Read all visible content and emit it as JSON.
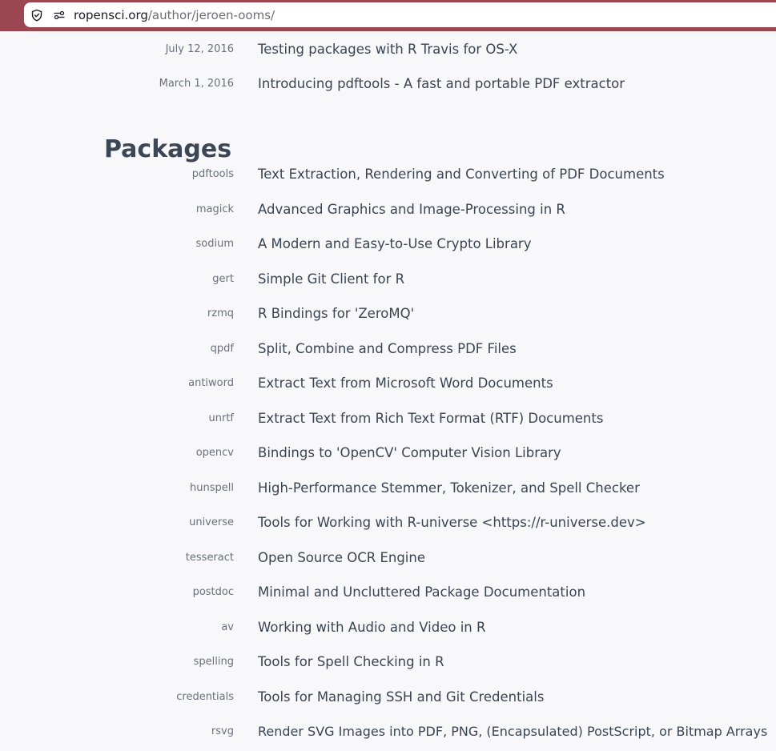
{
  "browser": {
    "url_host": "ropensci.org",
    "url_path": "/author/jeroen-ooms/"
  },
  "posts": [
    {
      "date": "July 12, 2016",
      "title": "Testing packages with R Travis for OS-X"
    },
    {
      "date": "March 1, 2016",
      "title": "Introducing pdftools - A fast and portable PDF extractor"
    }
  ],
  "packages_heading": "Packages",
  "packages": [
    {
      "name": "pdftools",
      "description": "Text Extraction, Rendering and Converting of PDF Documents"
    },
    {
      "name": "magick",
      "description": "Advanced Graphics and Image-Processing in R"
    },
    {
      "name": "sodium",
      "description": "A Modern and Easy-to-Use Crypto Library"
    },
    {
      "name": "gert",
      "description": "Simple Git Client for R"
    },
    {
      "name": "rzmq",
      "description": "R Bindings for 'ZeroMQ'"
    },
    {
      "name": "qpdf",
      "description": "Split, Combine and Compress PDF Files"
    },
    {
      "name": "antiword",
      "description": "Extract Text from Microsoft Word Documents"
    },
    {
      "name": "unrtf",
      "description": "Extract Text from Rich Text Format (RTF) Documents"
    },
    {
      "name": "opencv",
      "description": "Bindings to 'OpenCV' Computer Vision Library"
    },
    {
      "name": "hunspell",
      "description": "High-Performance Stemmer, Tokenizer, and Spell Checker"
    },
    {
      "name": "universe",
      "description": "Tools for Working with R-universe <https://r-universe.dev>"
    },
    {
      "name": "tesseract",
      "description": "Open Source OCR Engine"
    },
    {
      "name": "postdoc",
      "description": "Minimal and Uncluttered Package Documentation"
    },
    {
      "name": "av",
      "description": "Working with Audio and Video in R"
    },
    {
      "name": "spelling",
      "description": "Tools for Spell Checking in R"
    },
    {
      "name": "credentials",
      "description": "Tools for Managing SSH and Git Credentials"
    },
    {
      "name": "rsvg",
      "description": "Render SVG Images into PDF, PNG, (Encapsulated) PostScript, or Bitmap Arrays"
    }
  ]
}
